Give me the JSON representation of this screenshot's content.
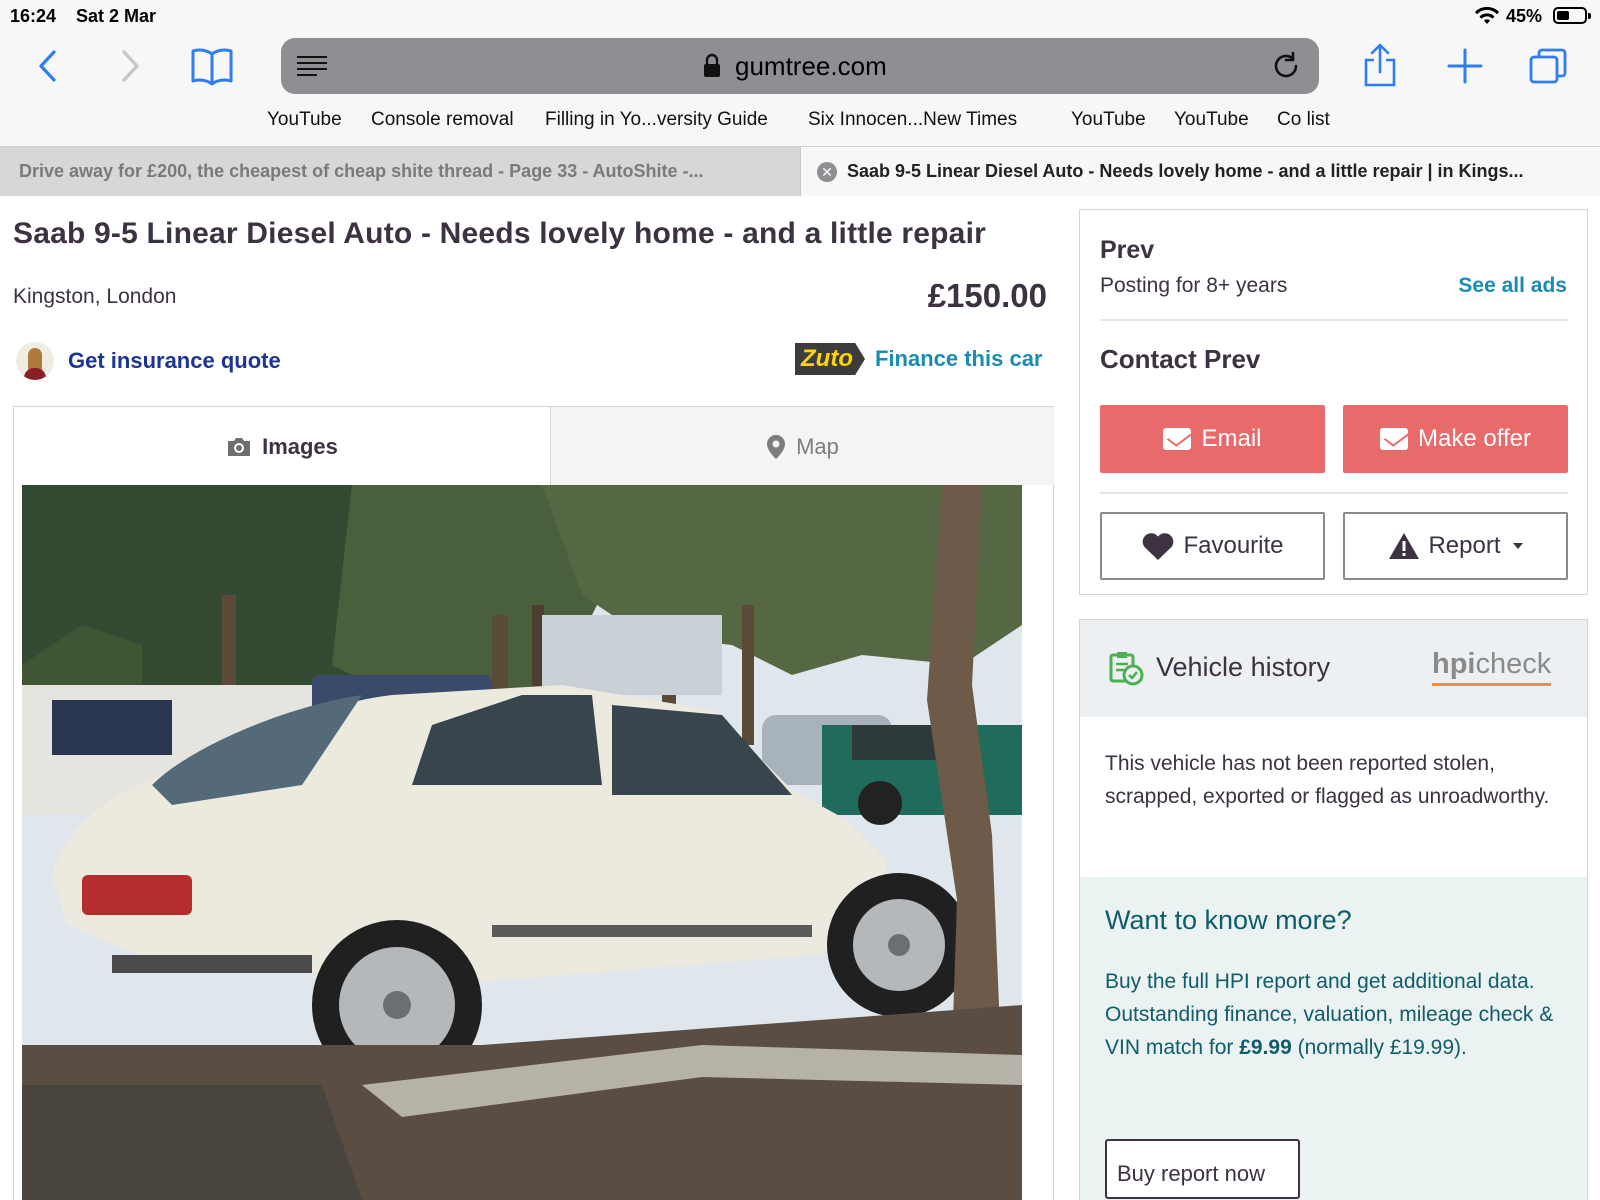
{
  "status_bar": {
    "time": "16:24",
    "date": "Sat 2 Mar",
    "battery": "45%"
  },
  "browser": {
    "url_host": "gumtree.com",
    "favourites": [
      "YouTube",
      "Console removal",
      "Filling in Yo...versity Guide",
      "Six Innocen...New Times",
      "YouTube",
      "YouTube",
      "Co list"
    ],
    "tabs": [
      {
        "title": "Drive away for £200, the cheapest of cheap shite thread - Page 33 - AutoShite -..."
      },
      {
        "title": "Saab 9-5 Linear Diesel Auto - Needs lovely home - and a little repair | in Kings..."
      }
    ]
  },
  "ad": {
    "title": "Saab 9-5 Linear Diesel Auto - Needs lovely home - and a little repair",
    "location": "Kingston, London",
    "price": "£150.00",
    "insurance_link": "Get insurance quote",
    "finance_logo": "Zuto",
    "finance_link": "Finance this car",
    "media_tabs": {
      "images": "Images",
      "map": "Map"
    }
  },
  "seller": {
    "name": "Prev",
    "posting_for": "Posting for 8+ years",
    "see_all": "See all ads",
    "contact_title": "Contact Prev",
    "email_label": "Email",
    "offer_label": "Make offer",
    "favourite_label": "Favourite",
    "report_label": "Report"
  },
  "vehicle_history": {
    "title": "Vehicle history",
    "logo_a": "hpi",
    "logo_b": "check",
    "status_text": "This vehicle has not been reported stolen, scrapped, exported or flagged as unroadworthy.",
    "more_title": "Want to know more?",
    "more_line1": "Buy the full HPI report and get additional data.",
    "more_line2_a": "Outstanding finance, valuation, mileage check & VIN match for ",
    "more_price": "£9.99",
    "more_line2_b": " (normally £19.99).",
    "buy_label": "Buy report now"
  },
  "colors": {
    "accent_red": "#e86a6a",
    "link_blue": "#1a8cb4",
    "insurance_blue": "#1c3494",
    "text": "#3c3241"
  }
}
